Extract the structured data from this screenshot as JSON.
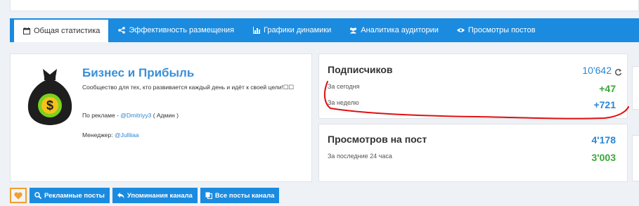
{
  "tabs": [
    {
      "label": "Общая статистика",
      "icon": "calendar-icon",
      "active": true
    },
    {
      "label": "Эффективность размещения",
      "icon": "share-icon"
    },
    {
      "label": "Графики динамики",
      "icon": "bar-chart-icon"
    },
    {
      "label": "Аналитика аудитории",
      "icon": "users-icon"
    },
    {
      "label": "Просмотры постов",
      "icon": "eye-icon"
    }
  ],
  "channel": {
    "title": "Бизнес и Прибыль",
    "description": "Сообщество для тех, кто развивается каждый день и идёт к своей цели!☐☐",
    "ad_prefix": "По рекламе - ",
    "ad_user": "@Dmitriyy3",
    "ad_role": " ( Админ )",
    "manager_prefix": "Менеджер: ",
    "manager_user": "@Julliiaa",
    "avatar_icon": "money-bag-icon"
  },
  "subscribers": {
    "title": "Подписчиков",
    "total": "10'642",
    "refresh_icon": "refresh-icon",
    "today_label": "За сегодня",
    "today_value": "+47",
    "week_label": "За неделю",
    "week_value": "+721"
  },
  "views": {
    "title": "Просмотров на пост",
    "total": "4'178",
    "period_label": "За последние 24 часа",
    "period_value": "3'003"
  },
  "actions": {
    "ads_posts": "Рекламные посты",
    "mentions": "Упоминания канала",
    "all_posts": "Все посты канала"
  },
  "colors": {
    "accent": "#1b8be0",
    "link": "#2a86d4",
    "positive": "#3aa63a",
    "annotation": "#e01010"
  }
}
